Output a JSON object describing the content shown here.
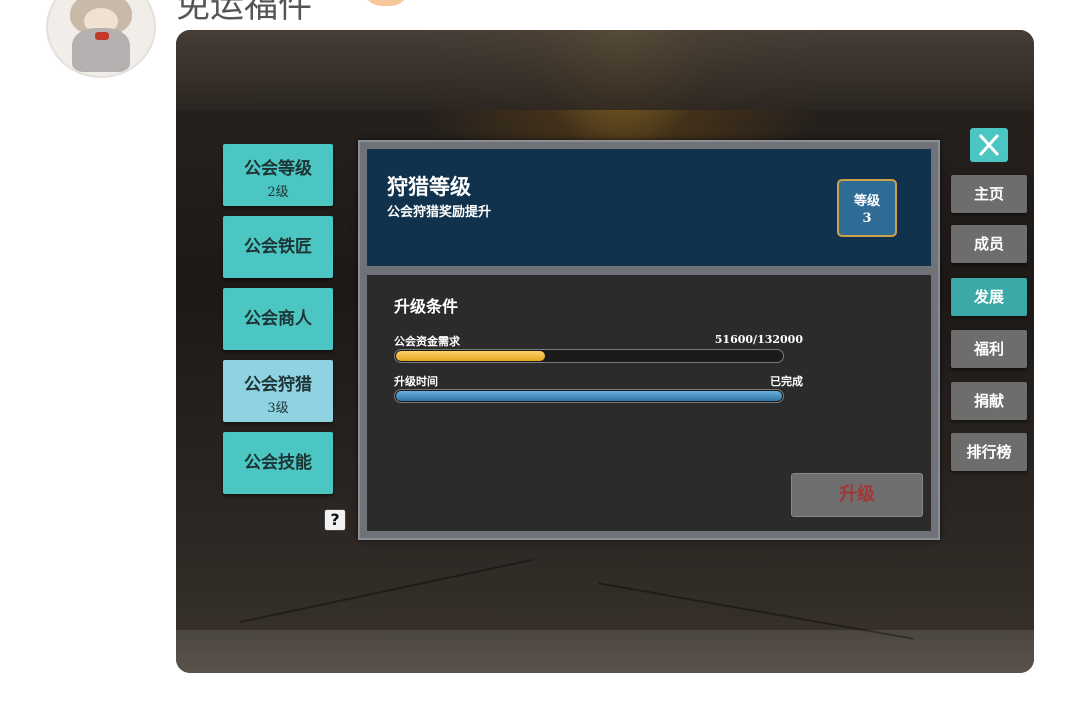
{
  "post": {
    "title": "免运福件",
    "avatar_icon": "plush-toy-avatar"
  },
  "tabs": [
    {
      "label": "公会等级",
      "sub": "2级",
      "active": false
    },
    {
      "label": "公会铁匠",
      "sub": "",
      "active": false
    },
    {
      "label": "公会商人",
      "sub": "",
      "active": false
    },
    {
      "label": "公会狩猎",
      "sub": "3级",
      "active": true
    },
    {
      "label": "公会技能",
      "sub": "",
      "active": false
    }
  ],
  "help_label": "?",
  "panel": {
    "title": "狩猎等级",
    "subtitle": "公会狩猎奖励提升",
    "level_label": "等级",
    "level_value": "3",
    "conditions_title": "升级条件",
    "funds_label": "公会资金需求",
    "funds_value": "51600/132000",
    "funds_progress": 0.39,
    "time_label": "升级时间",
    "time_value": "已完成",
    "time_progress": 1.0,
    "upgrade_label": "升级"
  },
  "side_menu": [
    {
      "label": "主页",
      "active": false
    },
    {
      "label": "成员",
      "active": false
    },
    {
      "label": "发展",
      "active": true
    },
    {
      "label": "福利",
      "active": false
    },
    {
      "label": "捐献",
      "active": false
    },
    {
      "label": "排行榜",
      "active": false
    }
  ],
  "colors": {
    "tab": "#4cc6c2",
    "tab_active": "#8fd3e3",
    "header_bg": "#10324c",
    "gold_bar": "#f0b732",
    "blue_bar": "#4a94c6",
    "side_active": "#3ba9a7"
  }
}
